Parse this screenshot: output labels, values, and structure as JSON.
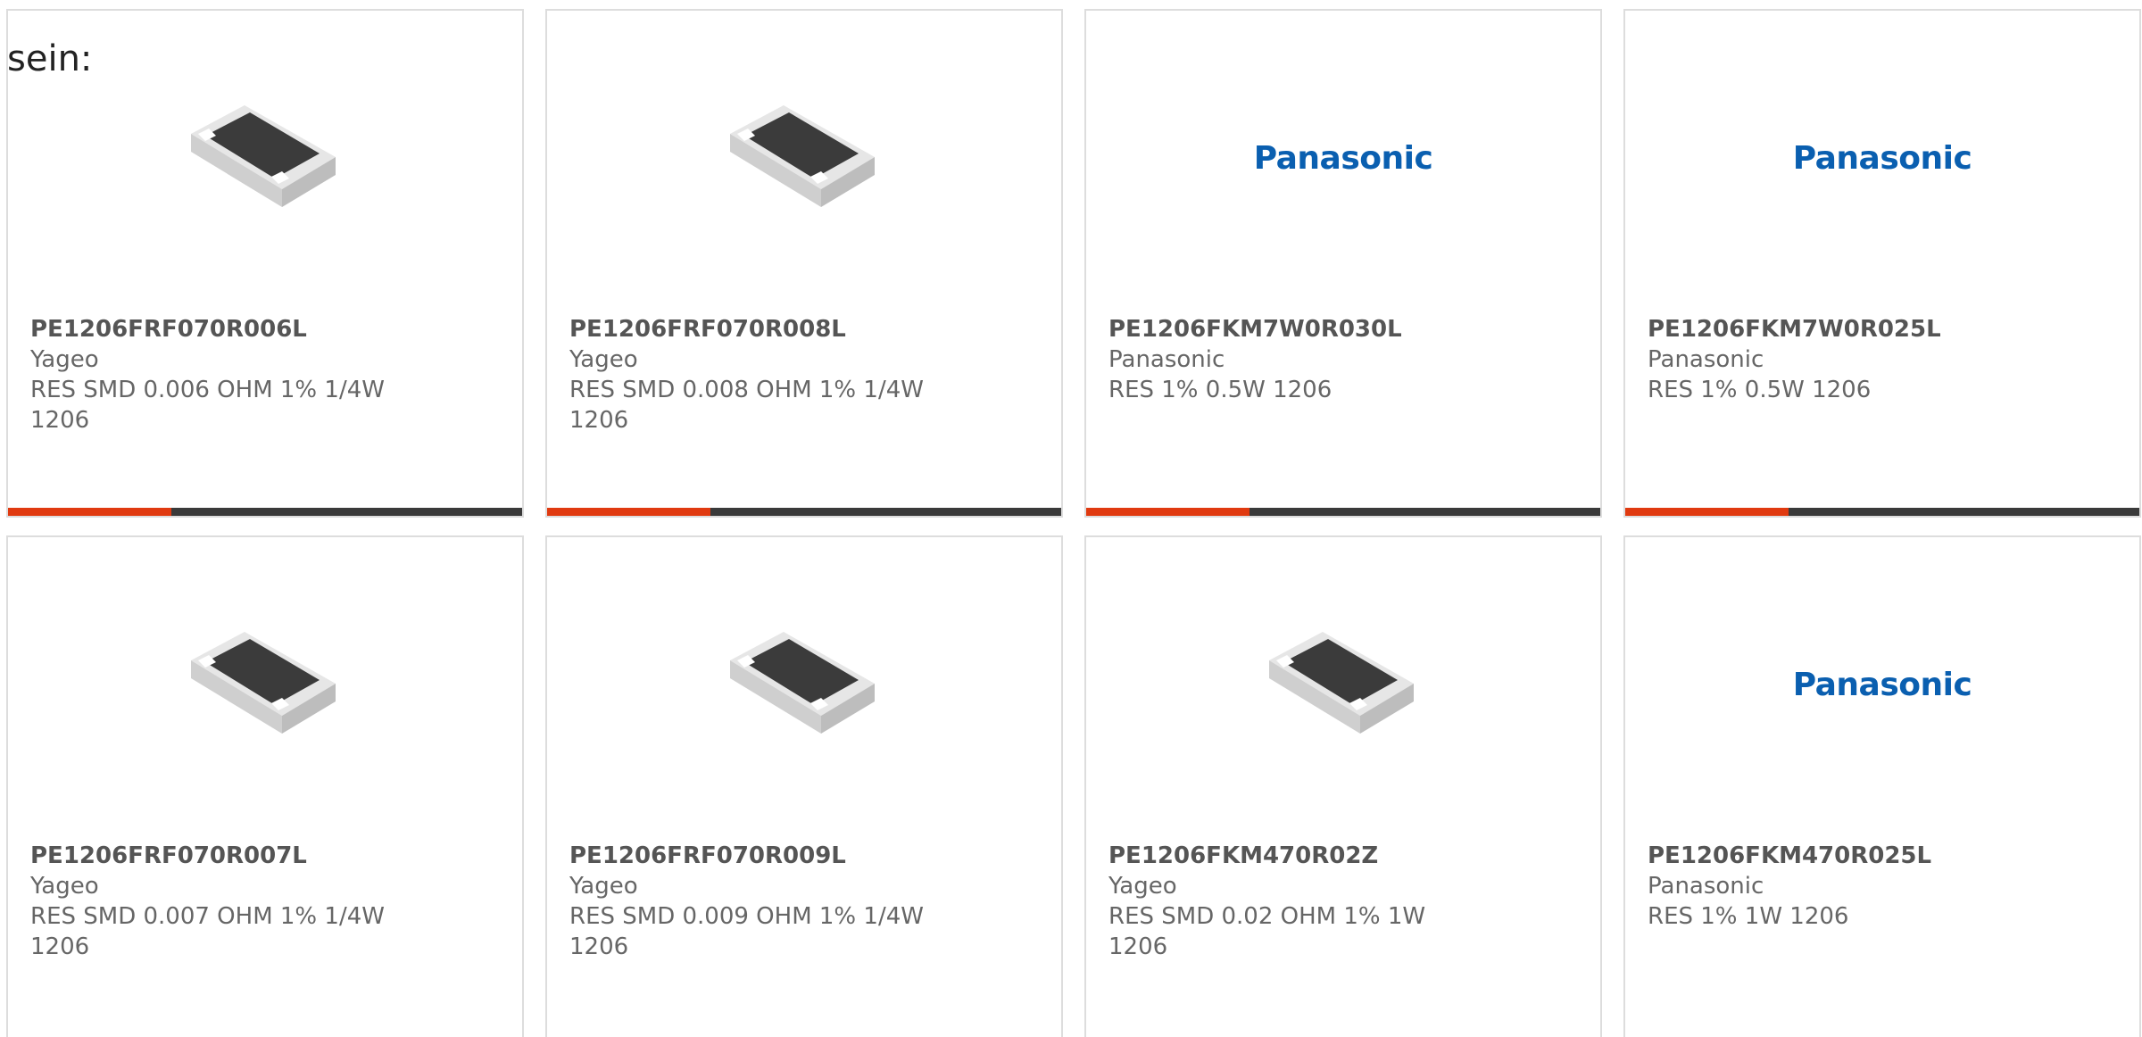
{
  "intro": {
    "text": "sein:"
  },
  "colors": {
    "accent": "#e03a10",
    "bar": "#3a3a3a",
    "border": "#dddddd",
    "text": "#666666",
    "brand_logo": "#0a5fb0"
  },
  "products": [
    {
      "part": "PE1206FRF070R006L",
      "manufacturer": "Yageo",
      "description": "RES SMD 0.006 OHM 1% 1/4W 1206",
      "image": "resistor-chip-image"
    },
    {
      "part": "PE1206FRF070R008L",
      "manufacturer": "Yageo",
      "description": "RES SMD 0.008 OHM 1% 1/4W 1206",
      "image": "resistor-chip-image"
    },
    {
      "part": "PE1206FKM7W0R030L",
      "manufacturer": "Panasonic",
      "description": "RES 1% 0.5W 1206",
      "image": "panasonic-logo",
      "logo_text": "Panasonic"
    },
    {
      "part": "PE1206FKM7W0R025L",
      "manufacturer": "Panasonic",
      "description": "RES 1% 0.5W 1206",
      "image": "panasonic-logo",
      "logo_text": "Panasonic"
    },
    {
      "part": "PE1206FRF070R007L",
      "manufacturer": "Yageo",
      "description": "RES SMD 0.007 OHM 1% 1/4W 1206",
      "image": "resistor-chip-image"
    },
    {
      "part": "PE1206FRF070R009L",
      "manufacturer": "Yageo",
      "description": "RES SMD 0.009 OHM 1% 1/4W 1206",
      "image": "resistor-chip-image"
    },
    {
      "part": "PE1206FKM470R02Z",
      "manufacturer": "Yageo",
      "description": "RES SMD 0.02 OHM 1% 1W 1206",
      "image": "resistor-chip-image"
    },
    {
      "part": "PE1206FKM470R025L",
      "manufacturer": "Panasonic",
      "description": "RES 1% 1W 1206",
      "image": "panasonic-logo",
      "logo_text": "Panasonic"
    }
  ]
}
